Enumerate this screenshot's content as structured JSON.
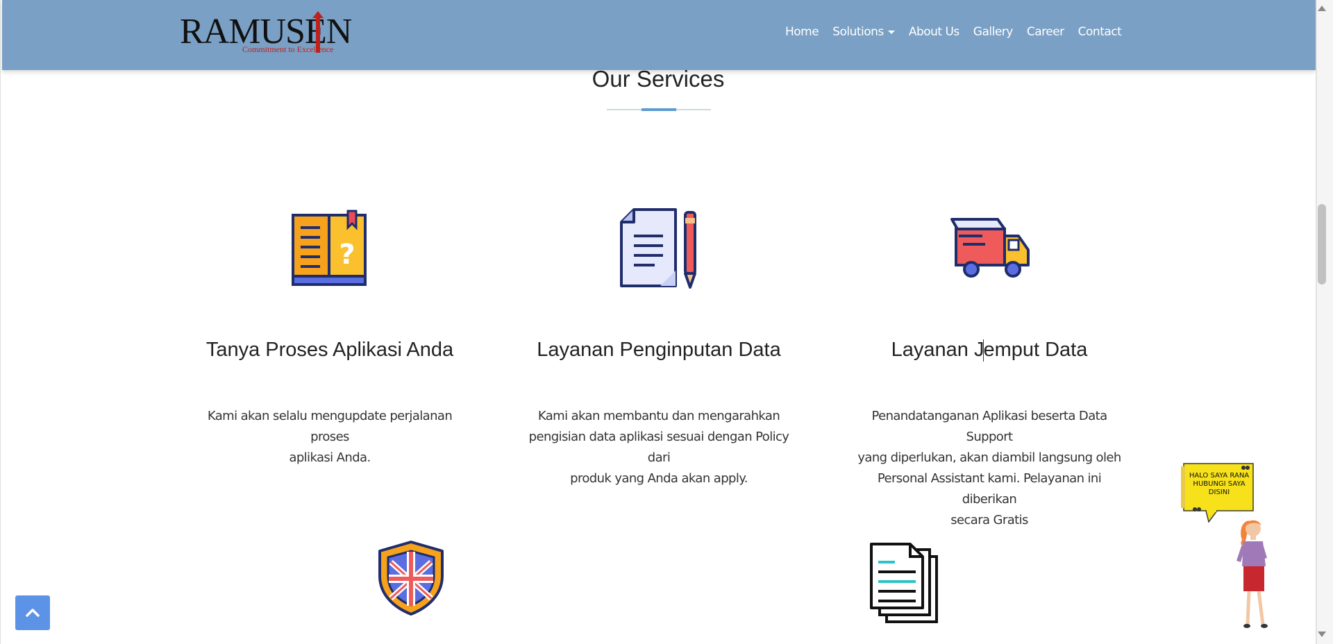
{
  "header": {
    "logo": {
      "wordmark": "RAMUSEN",
      "tagline": "Commitment to Excellence"
    },
    "nav": [
      {
        "label": "Home"
      },
      {
        "label": "Solutions"
      },
      {
        "label": "About Us"
      },
      {
        "label": "Gallery"
      },
      {
        "label": "Career"
      },
      {
        "label": "Contact"
      }
    ]
  },
  "services": {
    "title": "Our Services",
    "cards": [
      {
        "icon": "open-book-question-icon",
        "title": "Tanya Proses Aplikasi Anda",
        "desc_lines": [
          "Kami akan selalu mengupdate perjalanan proses",
          "aplikasi Anda."
        ]
      },
      {
        "icon": "document-pencil-icon",
        "title": "Layanan Penginputan Data",
        "desc_lines": [
          "Kami akan membantu dan mengarahkan",
          "pengisian data aplikasi sesuai dengan Policy dari",
          "produk yang Anda akan apply."
        ]
      },
      {
        "icon": "delivery-truck-icon",
        "title_before_cursor": "Layanan J",
        "title_after_cursor": "emput Data",
        "desc_lines": [
          "Penandatanganan Aplikasi beserta Data Support",
          "yang diperlukan, akan diambil langsung oleh",
          "Personal Assistant kami. Pelayanan ini diberikan",
          "secara Gratis"
        ]
      }
    ],
    "next_row_icons": [
      "shield-flag-icon",
      "documents-stack-icon"
    ]
  },
  "chat_widget": {
    "lines": [
      "HALO SAYA RANA",
      "HUBUNGI SAYA",
      "DISINI"
    ]
  },
  "colors": {
    "navbar": "#7aa0c5",
    "accent": "#5d9bd0",
    "back_to_top": "#5d93e6",
    "logo_red": "#c0201a",
    "bubble": "#f6e11a"
  }
}
